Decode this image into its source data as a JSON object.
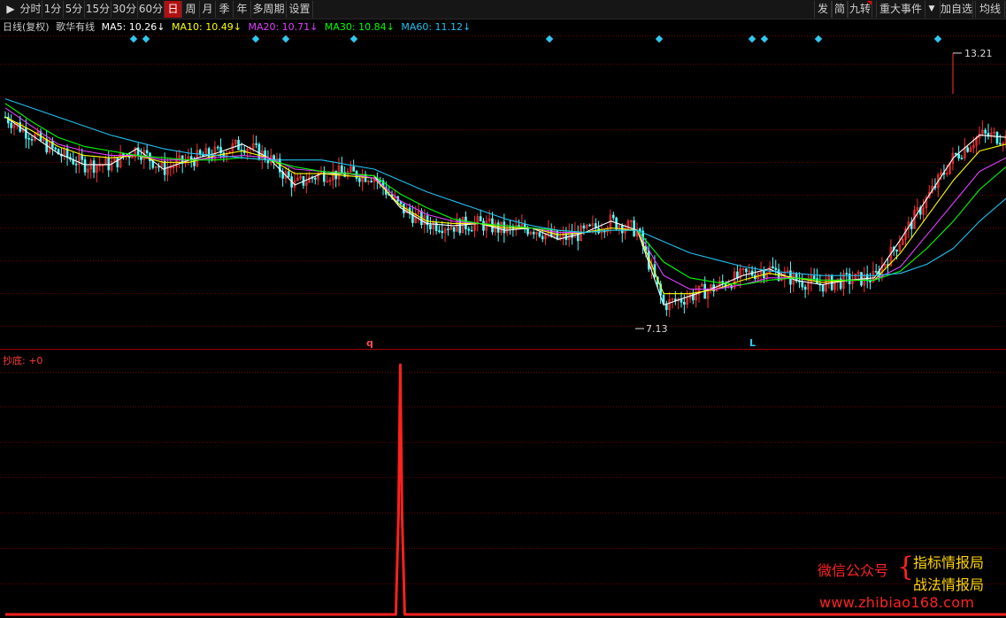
{
  "toolbar": {
    "left_tabs": [
      "分时",
      "1分",
      "5分",
      "15分",
      "30分",
      "60分",
      "日",
      "周",
      "月",
      "季",
      "年",
      "多周期",
      "设置"
    ],
    "active_tab": "日",
    "right_buttons": [
      "发",
      "简",
      "九转",
      "重大事件",
      "加自选",
      "均线"
    ]
  },
  "info_bar": {
    "mode": "日线(复权)",
    "stock": "歌华有线",
    "ma5": "MA5: 10.26↓",
    "ma10": "MA10: 10.49↓",
    "ma20": "MA20: 10.71↓",
    "ma30": "MA30: 10.84↓",
    "ma60": "MA60: 11.12↓"
  },
  "colors": {
    "ma5": "#ffffff",
    "ma10": "#ffff00",
    "ma20": "#e040ff",
    "ma30": "#00ff00",
    "ma60": "#20c0f0",
    "up": "#ff3232",
    "down": "#54ffff",
    "indicator": "#ff2020",
    "grid": "#6a0000"
  },
  "chart_data": [
    {
      "type": "candlestick",
      "series": [
        {
          "name": "MA5",
          "y": [
            11.8,
            11.4,
            11.0,
            10.75,
            10.75,
            11.1,
            10.65,
            10.85,
            11.0,
            11.2,
            10.9,
            10.3,
            10.55,
            10.55,
            10.5,
            9.8,
            9.45,
            9.4,
            9.45,
            9.3,
            9.35,
            9.1,
            9.25,
            9.5,
            9.3,
            7.65,
            7.85,
            8.05,
            8.3,
            8.45,
            8.2,
            8.1,
            8.2,
            8.25,
            9.1,
            10.0,
            10.9,
            11.4,
            11.35
          ]
        },
        {
          "name": "MA10",
          "y": [
            11.8,
            11.5,
            11.15,
            10.95,
            10.9,
            10.95,
            10.8,
            10.8,
            10.95,
            11.05,
            10.9,
            10.55,
            10.55,
            10.5,
            10.45,
            9.85,
            9.5,
            9.45,
            9.45,
            9.35,
            9.35,
            9.2,
            9.25,
            9.35,
            9.3,
            7.9,
            7.9,
            8.0,
            8.2,
            8.35,
            8.25,
            8.15,
            8.2,
            8.2,
            8.8,
            9.6,
            10.4,
            11.05,
            11.2
          ]
        },
        {
          "name": "MA20",
          "y": [
            12.0,
            11.6,
            11.2,
            11.05,
            10.95,
            10.95,
            10.85,
            10.85,
            10.9,
            10.95,
            10.9,
            10.65,
            10.6,
            10.55,
            10.45,
            9.95,
            9.65,
            9.5,
            9.45,
            9.4,
            9.35,
            9.25,
            9.25,
            9.3,
            9.3,
            8.3,
            8.0,
            8.0,
            8.1,
            8.25,
            8.25,
            8.2,
            8.2,
            8.2,
            8.5,
            9.2,
            9.9,
            10.6,
            10.9
          ]
        },
        {
          "name": "MA30",
          "y": [
            12.1,
            11.7,
            11.35,
            11.15,
            11.05,
            10.95,
            10.9,
            10.85,
            10.85,
            10.9,
            10.85,
            10.7,
            10.6,
            10.55,
            10.5,
            10.1,
            9.8,
            9.55,
            9.45,
            9.4,
            9.35,
            9.3,
            9.25,
            9.3,
            9.3,
            8.6,
            8.25,
            8.15,
            8.1,
            8.2,
            8.25,
            8.2,
            8.2,
            8.2,
            8.4,
            8.9,
            9.5,
            10.2,
            10.7
          ]
        },
        {
          "name": "MA60",
          "y": [
            12.2,
            12.0,
            11.8,
            11.6,
            11.4,
            11.25,
            11.1,
            11.0,
            10.95,
            10.9,
            10.85,
            10.85,
            10.85,
            10.75,
            10.65,
            10.4,
            10.15,
            9.95,
            9.75,
            9.55,
            9.4,
            9.3,
            9.25,
            9.3,
            9.3,
            9.05,
            8.8,
            8.65,
            8.5,
            8.4,
            8.35,
            8.3,
            8.3,
            8.3,
            8.35,
            8.55,
            8.9,
            9.5,
            10.0
          ]
        }
      ],
      "annotations": [
        {
          "text": "13.21",
          "y": 13.21
        },
        {
          "text": "7.13",
          "y": 7.13
        },
        {
          "text": "q"
        },
        {
          "text": "L"
        }
      ]
    },
    {
      "type": "line",
      "series": [
        {
          "name": "抄底",
          "label": "抄底: +0",
          "y": [
            0,
            0,
            0,
            0,
            0,
            0,
            0,
            0,
            0,
            0,
            0,
            0,
            0,
            0,
            0,
            1,
            0,
            0,
            0,
            0,
            0,
            0,
            0,
            0,
            0,
            0,
            0,
            0,
            0,
            0,
            0,
            0,
            0,
            0,
            0,
            0,
            0,
            0,
            0
          ]
        }
      ]
    }
  ],
  "watermark": {
    "wechat": "微信公众号",
    "brace": "{",
    "name1": "指标情报局",
    "name2": "战法情报局",
    "url": "www.zhibiao168.com"
  }
}
